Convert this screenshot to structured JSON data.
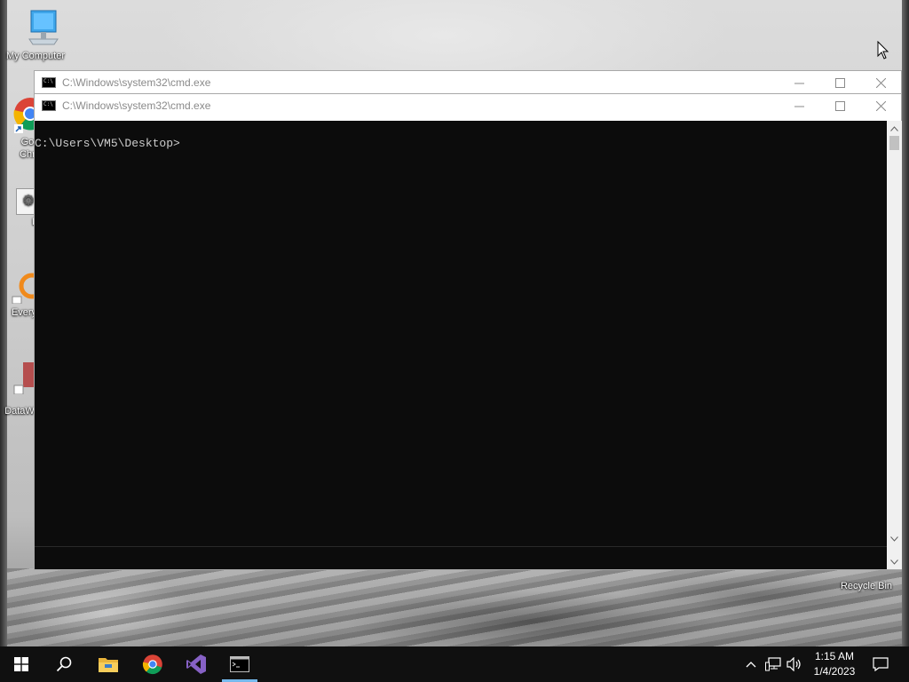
{
  "desktop": {
    "icons": [
      {
        "label": "My Computer"
      },
      {
        "label": "Goo\nChro"
      },
      {
        "label": "L"
      },
      {
        "label": "Every"
      },
      {
        "label": "DataW"
      },
      {
        "label": "Recycle Bin"
      }
    ]
  },
  "windows": [
    {
      "title": "C:\\Windows\\system32\\cmd.exe"
    },
    {
      "title": "C:\\Windows\\system32\\cmd.exe",
      "prompt": "C:\\Users\\VM5\\Desktop>"
    }
  ],
  "taskbar": {
    "apps": [
      "start",
      "search",
      "file-explorer",
      "chrome",
      "visual-studio",
      "command-prompt"
    ],
    "clock": {
      "time": "1:15 AM",
      "date": "1/4/2023"
    }
  },
  "colors": {
    "console_bg": "#0c0c0c",
    "console_fg": "#cccccc",
    "taskbar_bg": "#101010",
    "accent": "#76b9ed"
  }
}
